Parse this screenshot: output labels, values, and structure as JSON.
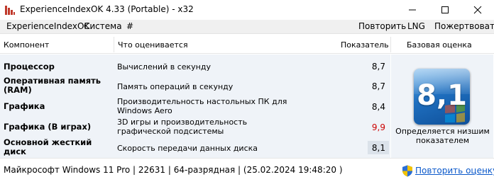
{
  "window": {
    "title": "ExperienceIndexOK 4.33 (Portable) - x32"
  },
  "menu": {
    "left": [
      "ExperienceIndexOK",
      "Система",
      "#"
    ],
    "right": [
      "Повторить",
      "LNG",
      "Пожертвовать"
    ]
  },
  "table": {
    "headers": {
      "component": "Компонент",
      "description": "Что оценивается",
      "score": "Показатель",
      "base": "Базовая оценка"
    },
    "rows": [
      {
        "component": "Процессор",
        "description": "Вычислений в секунду",
        "score": "8,7"
      },
      {
        "component": "Оперативная память (RAM)",
        "description": "Память операций в секунду",
        "score": "8,7"
      },
      {
        "component": "Графика",
        "description": "Производительность настольных ПК для Windows Aero",
        "score": "8,4"
      },
      {
        "component": "Графика (В играх)",
        "description": "3D игры и производительность графической подсистемы",
        "score": "9,9"
      },
      {
        "component": "Основной жесткий диск",
        "description": "Скорость передачи данных диска",
        "score": "8,1"
      }
    ]
  },
  "base_score": {
    "value": "8,1",
    "caption": "Определяется низшим показателем"
  },
  "status": {
    "system_info": "Майкрософт Windows 11 Pro | 22631 | 64-разрядная | (25.02.2024 19:48:20 )",
    "rate_link": "Повторить оценку"
  },
  "colors": {
    "highlight_score": "#cc0000",
    "link": "#0a58ca",
    "table_bg": "#eff3f8"
  },
  "icons": {
    "app": "bar-chart-icon",
    "minimize": "minimize-icon",
    "maximize": "maximize-icon",
    "close": "close-icon",
    "badge": "windows-score-badge",
    "shield": "uac-shield-icon"
  }
}
